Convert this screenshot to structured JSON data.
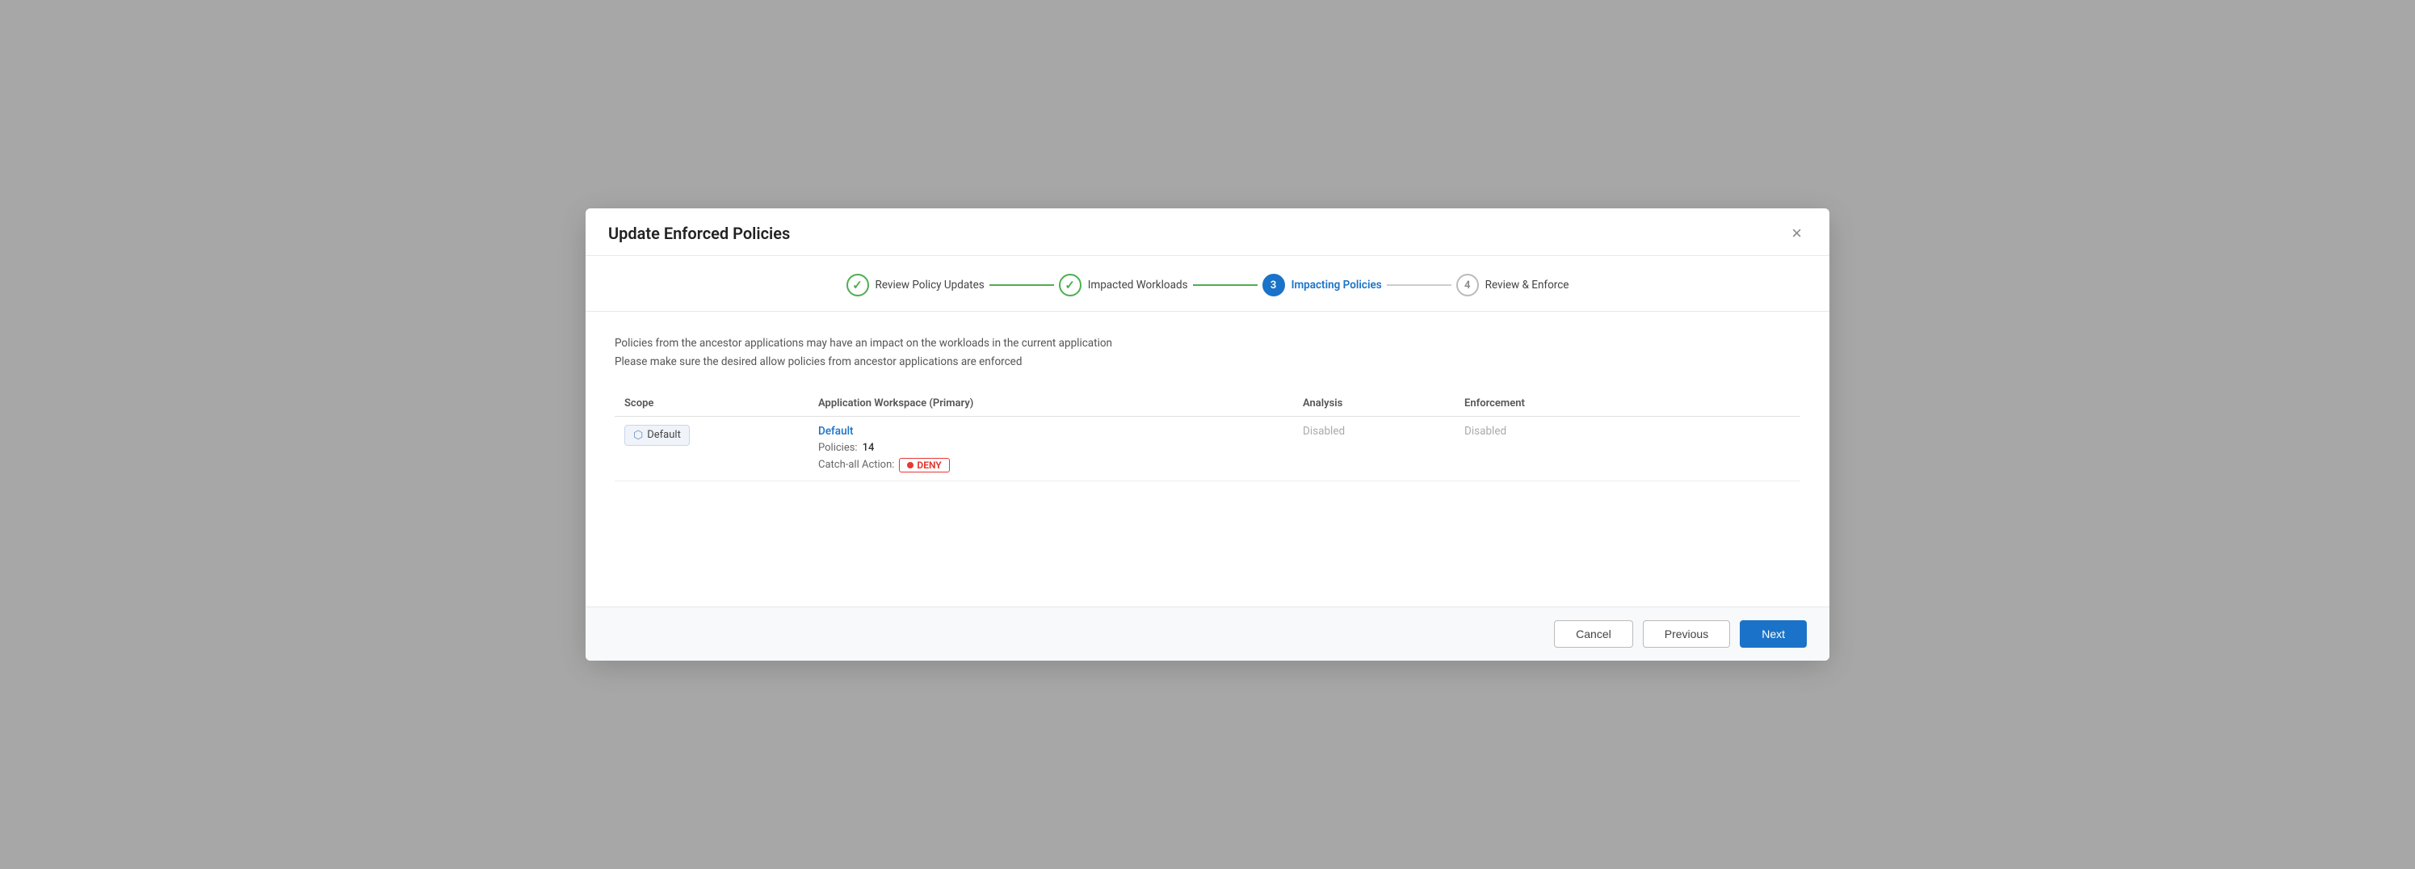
{
  "modal": {
    "title": "Update Enforced Policies",
    "close_label": "×"
  },
  "stepper": {
    "steps": [
      {
        "id": "review-policy-updates",
        "number": "1",
        "label": "Review Policy Updates",
        "state": "done"
      },
      {
        "id": "impacted-workloads",
        "number": "2",
        "label": "Impacted Workloads",
        "state": "done"
      },
      {
        "id": "impacting-policies",
        "number": "3",
        "label": "Impacting Policies",
        "state": "active"
      },
      {
        "id": "review-enforce",
        "number": "4",
        "label": "Review & Enforce",
        "state": "inactive"
      }
    ],
    "connector_1_done": true,
    "connector_2_done": true,
    "connector_3_done": false
  },
  "body": {
    "info_line1": "Policies from the ancestor applications may have an impact on the workloads in the current application",
    "info_line2": "Please make sure the desired allow policies from ancestor applications are enforced"
  },
  "table": {
    "columns": [
      {
        "id": "scope",
        "label": "Scope"
      },
      {
        "id": "workspace",
        "label": "Application Workspace (Primary)"
      },
      {
        "id": "analysis",
        "label": "Analysis"
      },
      {
        "id": "enforcement",
        "label": "Enforcement"
      }
    ],
    "rows": [
      {
        "scope": "Default",
        "workspace_name": "Default",
        "policies_label": "Policies:",
        "policies_value": "14",
        "catch_all_label": "Catch-all Action:",
        "catch_all_value": "DENY",
        "analysis": "Disabled",
        "enforcement": "Disabled"
      }
    ]
  },
  "footer": {
    "cancel_label": "Cancel",
    "previous_label": "Previous",
    "next_label": "Next"
  }
}
